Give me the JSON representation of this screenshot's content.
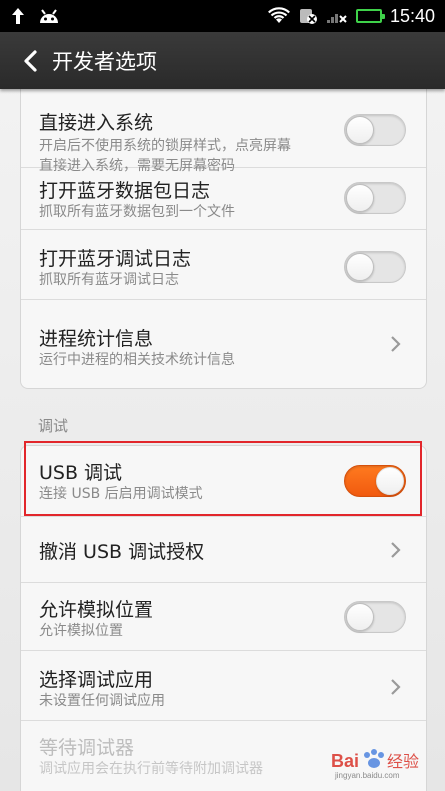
{
  "status_bar": {
    "time": "15:40",
    "icons": [
      "upload-arrow-icon",
      "android-icon",
      "wifi-icon",
      "sim-icon",
      "signal-icon",
      "battery-icon"
    ]
  },
  "header": {
    "back_icon": "chevron-left-icon",
    "title": "开发者选项"
  },
  "top_card": {
    "items": [
      {
        "title": "直接进入系统",
        "subtitle": "开启后不使用系统的锁屏样式，点亮屏幕\n直接进入系统，需要无屏幕密码",
        "control": "toggle",
        "on": false
      },
      {
        "title": "打开蓝牙数据包日志",
        "subtitle": "抓取所有蓝牙数据包到一个文件",
        "control": "toggle",
        "on": false
      },
      {
        "title": "打开蓝牙调试日志",
        "subtitle": "抓取所有蓝牙调试日志",
        "control": "toggle",
        "on": false
      },
      {
        "title": "进程统计信息",
        "subtitle": "运行中进程的相关技术统计信息",
        "control": "chevron"
      }
    ]
  },
  "debug_section": {
    "label": "调试",
    "items": [
      {
        "title": "USB 调试",
        "subtitle": "连接 USB 后启用调试模式",
        "control": "toggle",
        "on": true
      },
      {
        "title": "撤消 USB 调试授权",
        "subtitle": "",
        "control": "chevron"
      },
      {
        "title": "允许模拟位置",
        "subtitle": "允许模拟位置",
        "control": "toggle",
        "on": false
      },
      {
        "title": "选择调试应用",
        "subtitle": "未设置任何调试应用",
        "control": "chevron"
      },
      {
        "title": "等待调试器",
        "subtitle": "调试应用会在执行前等待附加调试器",
        "control": "none",
        "disabled": true
      }
    ]
  },
  "colors": {
    "accent_toggle_on": "#f15a0f",
    "highlight_box": "#e2262b",
    "battery": "#3fd24a"
  }
}
